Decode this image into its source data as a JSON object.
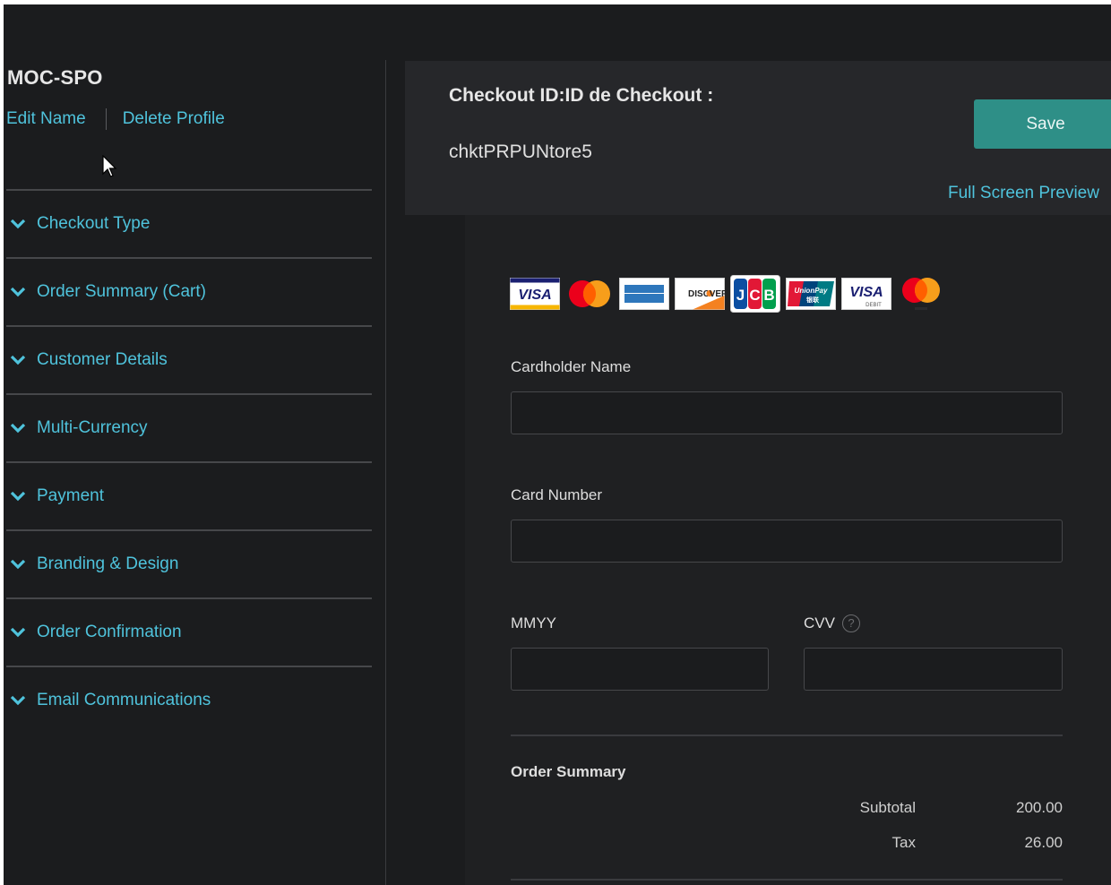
{
  "profile": {
    "name": "MOC-SPO",
    "edit_label": "Edit Name",
    "delete_label": "Delete Profile"
  },
  "sidebar": {
    "sections": [
      {
        "label": "Checkout Type"
      },
      {
        "label": "Order Summary (Cart)"
      },
      {
        "label": "Customer Details"
      },
      {
        "label": "Multi-Currency"
      },
      {
        "label": "Payment"
      },
      {
        "label": "Branding & Design"
      },
      {
        "label": "Order Confirmation"
      },
      {
        "label": "Email Communications"
      }
    ]
  },
  "header": {
    "title": "Checkout ID:ID de Checkout :",
    "checkout_id": "chktPRPUNtore5",
    "save_label": "Save",
    "preview_label": "Full Screen Preview"
  },
  "payment_form": {
    "card_logos": [
      "visa",
      "mastercard",
      "american-express",
      "discover",
      "jcb",
      "unionpay",
      "visa-debit",
      "maestro"
    ],
    "cardholder_label": "Cardholder Name",
    "cardholder_value": "",
    "card_number_label": "Card Number",
    "card_number_value": "",
    "expiry_label": "MMYY",
    "expiry_value": "",
    "cvv_label": "CVV",
    "cvv_help_icon": "?"
  },
  "order_summary": {
    "title": "Order Summary",
    "rows": [
      {
        "label": "Subtotal",
        "value": "200.00"
      },
      {
        "label": "Tax",
        "value": "26.00"
      }
    ]
  },
  "colors": {
    "background": "#1b1c1e",
    "panel": "#26272a",
    "accent_link": "#4fc3dc",
    "save_button": "#2e8f87"
  }
}
